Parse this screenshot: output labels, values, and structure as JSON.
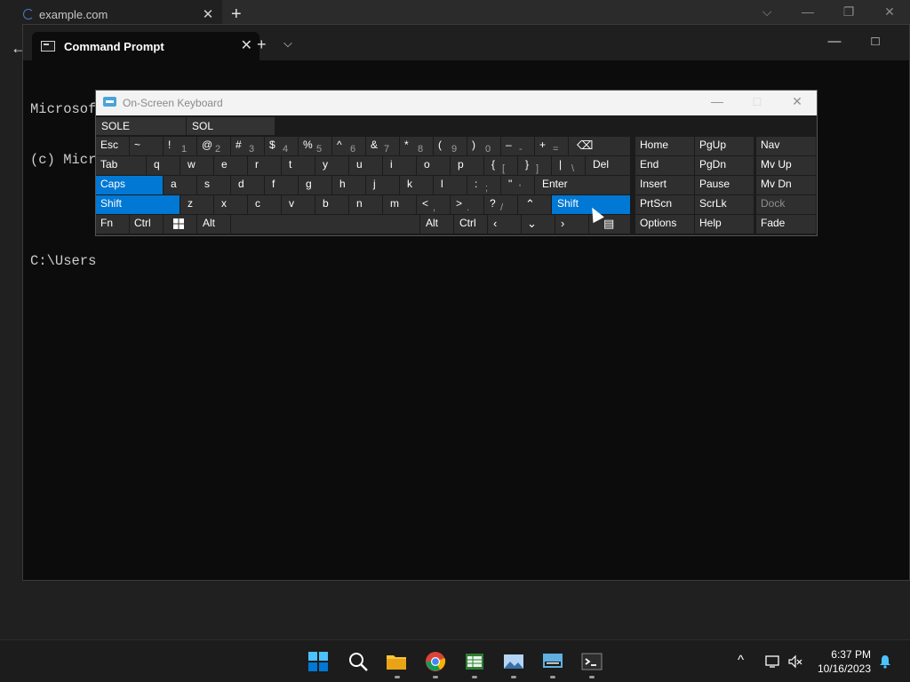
{
  "browser": {
    "tab_title": "example.com",
    "tab_close": "✕",
    "new_tab": "+",
    "controls": [
      "⌵",
      "—",
      "❐",
      "✕"
    ],
    "back": "←"
  },
  "terminal": {
    "tab_title": "Command Prompt",
    "tab_close": "✕",
    "new_tab": "+",
    "dropdown": "⌵",
    "controls": [
      "—",
      "□"
    ],
    "lines": [
      "Microsoft Windows [Version 10.0.25947.1000]",
      "(c) Micr",
      "",
      "C:\\Users"
    ]
  },
  "osk": {
    "title": "On-Screen Keyboard",
    "controls": [
      "—",
      "□",
      "✕"
    ],
    "predictions": [
      "SOLE",
      "SOL"
    ],
    "keys": {
      "esc": "Esc",
      "tilde": "~",
      "excl": "!",
      "one": "1",
      "at": "@",
      "two": "2",
      "hash": "#",
      "three": "3",
      "dollar": "$",
      "four": "4",
      "pct": "%",
      "five": "5",
      "caret": "^",
      "six": "6",
      "amp": "&",
      "seven": "7",
      "star": "*",
      "eight": "8",
      "lparen": "(",
      "nine": "9",
      "rparen": ")",
      "zero": "0",
      "minus": "–",
      "dash": "-",
      "plus": "+",
      "equals": "=",
      "backspace": "⌫",
      "tab": "Tab",
      "q": "q",
      "w": "w",
      "e": "e",
      "r": "r",
      "t": "t",
      "y": "y",
      "u": "u",
      "i": "i",
      "o": "o",
      "p": "p",
      "lbrace": "{",
      "lbracket": "[",
      "rbrace": "}",
      "rbracket": "]",
      "pipe": "|",
      "bslash": "\\",
      "del": "Del",
      "caps": "Caps",
      "a": "a",
      "s": "s",
      "d": "d",
      "f": "f",
      "g": "g",
      "h": "h",
      "j": "j",
      "k": "k",
      "l": "l",
      "colon": ":",
      "semicolon": ";",
      "quote": "\"",
      "apos": "'",
      "enter": "Enter",
      "shift_l": "Shift",
      "z": "z",
      "x": "x",
      "c": "c",
      "v": "v",
      "b": "b",
      "n": "n",
      "m": "m",
      "lt": "<",
      "comma": ",",
      "gt": ">",
      "period": ".",
      "question": "?",
      "slash": "/",
      "up": "⌃",
      "shift_r": "Shift",
      "fn": "Fn",
      "ctrl_l": "Ctrl",
      "alt_l": "Alt",
      "alt_r": "Alt",
      "ctrl_r": "Ctrl",
      "left": "‹",
      "down": "⌄",
      "right": "›",
      "menu": "▤",
      "home": "Home",
      "pgup": "PgUp",
      "nav": "Nav",
      "end": "End",
      "pgdn": "PgDn",
      "mvup": "Mv Up",
      "insert": "Insert",
      "pause": "Pause",
      "mvdn": "Mv Dn",
      "prtscn": "PrtScn",
      "scrlk": "ScrLk",
      "dock": "Dock",
      "options": "Options",
      "help": "Help",
      "fade": "Fade"
    }
  },
  "taskbar": {
    "apps": [
      "start-icon",
      "search-icon",
      "file-explorer-icon",
      "chrome-icon",
      "spreadsheet-app-icon",
      "photos-app-icon",
      "osk-app-icon",
      "terminal-app-icon"
    ],
    "tray_chevron": "^",
    "time": "6:37 PM",
    "date": "10/16/2023"
  },
  "colors": {
    "accent": "#0078d4",
    "key_bg": "#2f2f2f",
    "terminal_bg": "#0c0c0c"
  }
}
